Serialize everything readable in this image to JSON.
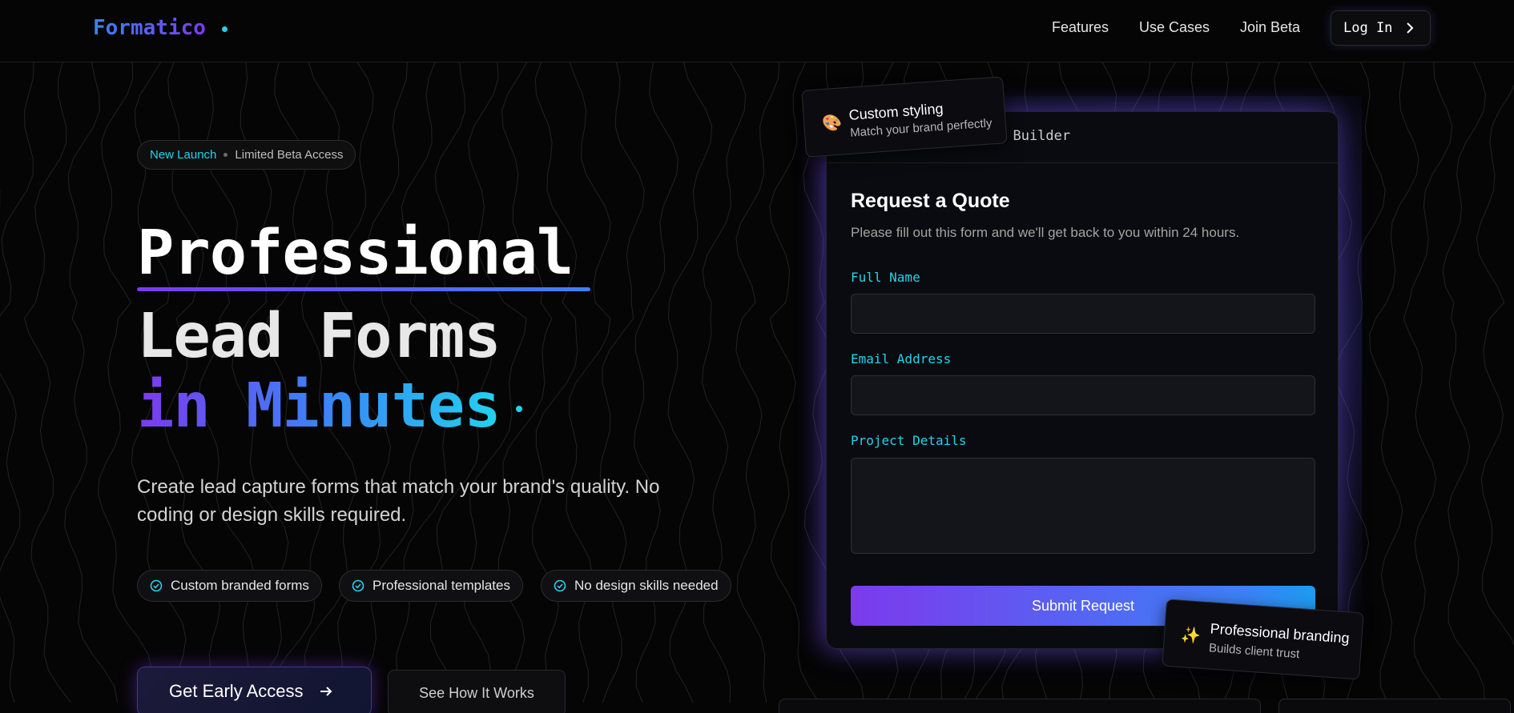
{
  "nav": {
    "logo": "Formatico",
    "links": [
      "Features",
      "Use Cases",
      "Join Beta"
    ],
    "login_label": "Log In"
  },
  "hero": {
    "badge_new": "New Launch",
    "badge_text": "Limited Beta Access",
    "line1": "Professional",
    "line2": "Lead Forms",
    "line3": "in Minutes",
    "subtitle": "Create lead capture forms that match your brand's quality. No coding or design skills required.",
    "chips": [
      "Custom branded forms",
      "Professional templates",
      "No design skills needed"
    ],
    "cta_primary": "Get Early Access",
    "cta_secondary": "See How It Works"
  },
  "form_card": {
    "header_title": "m Builder",
    "title": "Request a Quote",
    "description": "Please fill out this form and we'll get back to you within 24 hours.",
    "fields": [
      {
        "label": "Full Name",
        "value": ""
      },
      {
        "label": "Email Address",
        "value": ""
      },
      {
        "label": "Project Details",
        "value": ""
      }
    ],
    "submit_label": "Submit Request"
  },
  "tags": {
    "styling": {
      "title": "Custom styling",
      "subtitle": "Match your brand perfectly",
      "icon": "palette-icon"
    },
    "branding": {
      "title": "Professional branding",
      "subtitle": "Builds client trust",
      "icon": "sparkles-icon"
    }
  },
  "colors": {
    "accent_cyan": "#22d3ee",
    "accent_purple": "#7c3aed",
    "accent_blue": "#3b82f6",
    "background": "#050505"
  }
}
